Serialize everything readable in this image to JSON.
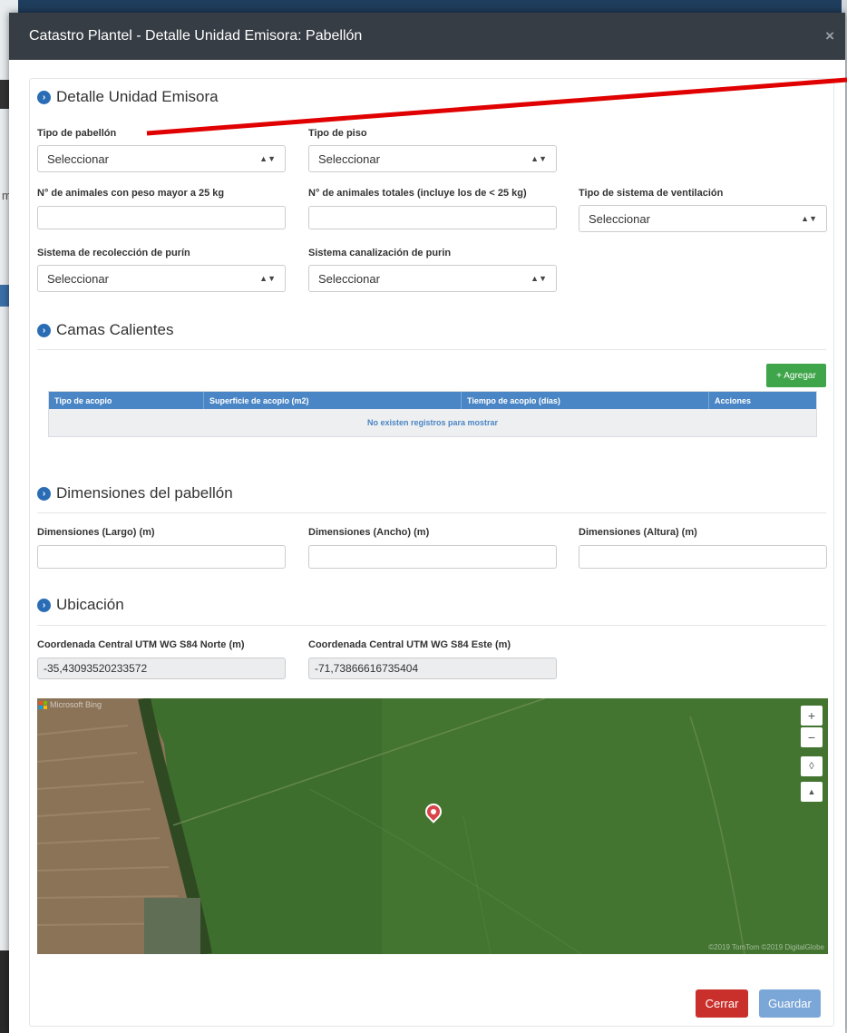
{
  "modal": {
    "title": "Catastro Plantel - Detalle Unidad Emisora: Pabellón",
    "close_symbol": "×"
  },
  "background": {
    "partial_letter": "m"
  },
  "sections": {
    "detalle": {
      "title": "Detalle Unidad Emisora",
      "icon": "chevron-right-circle-icon",
      "tipo_pabellon": {
        "label": "Tipo de pabellón",
        "value": "Seleccionar"
      },
      "tipo_piso": {
        "label": "Tipo de piso",
        "value": "Seleccionar"
      },
      "animales_mayor_25": {
        "label": "N° de animales con peso mayor a 25 kg",
        "value": ""
      },
      "animales_totales": {
        "label": "N° de animales totales (incluye los de < 25 kg)",
        "value": ""
      },
      "ventilacion": {
        "label": "Tipo de sistema de ventilación",
        "value": "Seleccionar"
      },
      "recoleccion_purin": {
        "label": "Sistema de recolección de purín",
        "value": "Seleccionar"
      },
      "canalizacion_purin": {
        "label": "Sistema canalización de purin",
        "value": "Seleccionar"
      }
    },
    "camas": {
      "title": "Camas Calientes",
      "add_button": "+ Agregar",
      "table": {
        "headers": [
          "Tipo de acopio",
          "Superficie de acopio (m2)",
          "Tiempo de acopio (días)",
          "Acciones"
        ],
        "empty_message": "No existen registros para mostrar"
      }
    },
    "dimensiones": {
      "title": "Dimensiones del pabellón",
      "largo": {
        "label": "Dimensiones (Largo) (m)",
        "value": ""
      },
      "ancho": {
        "label": "Dimensiones (Ancho) (m)",
        "value": ""
      },
      "altura": {
        "label": "Dimensiones (Altura) (m)",
        "value": ""
      }
    },
    "ubicacion": {
      "title": "Ubicación",
      "norte": {
        "label": "Coordenada Central UTM WG S84 Norte (m)",
        "value": "-35,43093520233572"
      },
      "este": {
        "label": "Coordenada Central UTM WG S84 Este (m)",
        "value": "-71,73866616735404"
      },
      "map": {
        "logo": "Microsoft Bing",
        "copyright": "©2019 TomTom ©2019 DigitalGlobe",
        "controls": [
          "+",
          "−",
          "◊",
          "▲"
        ]
      }
    }
  },
  "footer": {
    "cerrar": "Cerrar",
    "guardar": "Guardar"
  },
  "colors": {
    "header": "#373d44",
    "accent_blue": "#4a86c5",
    "add_green": "#3fa54a",
    "cerrar_red": "#c9302c",
    "guardar_blue": "#7aa6d8",
    "annotation_red": "#e00000"
  }
}
